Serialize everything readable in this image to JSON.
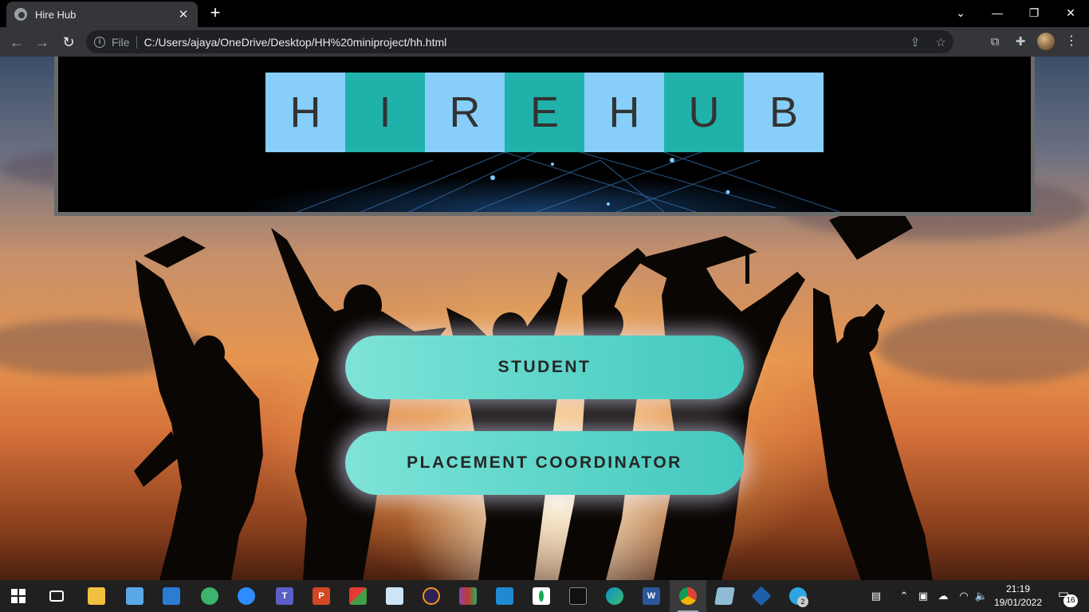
{
  "browser": {
    "tab_title": "Hire Hub",
    "file_label": "File",
    "url": "C:/Users/ajaya/OneDrive/Desktop/HH%20miniproject/hh.html"
  },
  "header": {
    "logo_letters": [
      "H",
      "I",
      "R",
      "E",
      "H",
      "U",
      "B"
    ],
    "colors": {
      "light_tile": "#87cefa",
      "teal_tile": "#20b2aa",
      "frame": "#6b6b6b"
    }
  },
  "buttons": {
    "student": "STUDENT",
    "coordinator": "PLACEMENT COORDINATOR",
    "accent": "#5fd6ca"
  },
  "taskbar": {
    "apps": [
      "windows-start",
      "task-view",
      "file-explorer",
      "this-pc",
      "news",
      "atom",
      "zoom",
      "teams",
      "powerpoint",
      "app-grid",
      "paint",
      "eclipse",
      "winrar",
      "vscode",
      "mongodb",
      "terminal",
      "edge",
      "word",
      "chrome",
      "notes",
      "virtualbox",
      "telegram"
    ],
    "telegram_badge": "2",
    "time": "21:19",
    "date": "19/01/2022",
    "notification_count": "16"
  }
}
